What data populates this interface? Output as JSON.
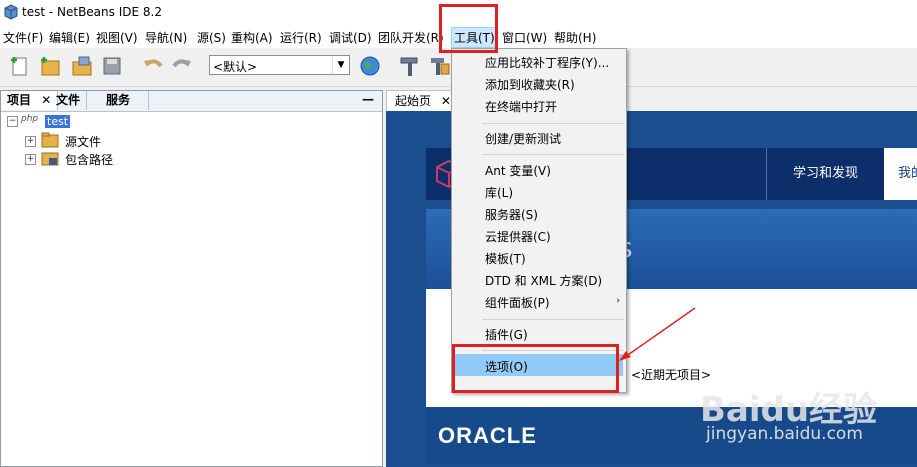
{
  "window": {
    "title": "test - NetBeans IDE 8.2"
  },
  "menubar": {
    "items": [
      "文件(F)",
      "编辑(E)",
      "视图(V)",
      "导航(N)",
      "源(S)",
      "重构(A)",
      "运行(R)",
      "调试(D)",
      "团队开发(R)",
      "工具(T)",
      "窗口(W)",
      "帮助(H)"
    ]
  },
  "toolbar": {
    "config_value": "<默认>",
    "icons": [
      "new-file-icon",
      "new-project-icon",
      "open-project-icon",
      "save-all-icon",
      "undo-icon",
      "redo-icon",
      "globe-icon",
      "build-hammer-icon",
      "clean-build-icon"
    ]
  },
  "left_panel": {
    "tabs": [
      "项目",
      "文件",
      "服务"
    ],
    "tree": {
      "root": {
        "badge": "php",
        "label": "test"
      },
      "children": [
        "源文件",
        "包含路径"
      ]
    }
  },
  "editor": {
    "tab": "起始页",
    "start_page": {
      "nav_learn": "学习和发现",
      "nav_my": "我的",
      "banner_fragment": "s",
      "no_recent": "<近期无项目>",
      "footer_logo": "ORACLE"
    }
  },
  "tools_menu": {
    "items": [
      "应用比较补丁程序(Y)...",
      "添加到收藏夹(R)",
      "在终端中打开",
      "创建/更新测试",
      "Ant 变量(V)",
      "库(L)",
      "服务器(S)",
      "云提供器(C)",
      "模板(T)",
      "DTD 和 XML 方案(D)",
      "组件面板(P)",
      "插件(G)",
      "选项(O)"
    ],
    "selected": "选项(O)"
  },
  "watermark": {
    "text": "Baidu经验",
    "url": "jingyan.baidu.com"
  },
  "colors": {
    "highlight": "#91c9f7",
    "annotation_red": "#e0201f",
    "start_page_blue": "#1a4e8f"
  }
}
